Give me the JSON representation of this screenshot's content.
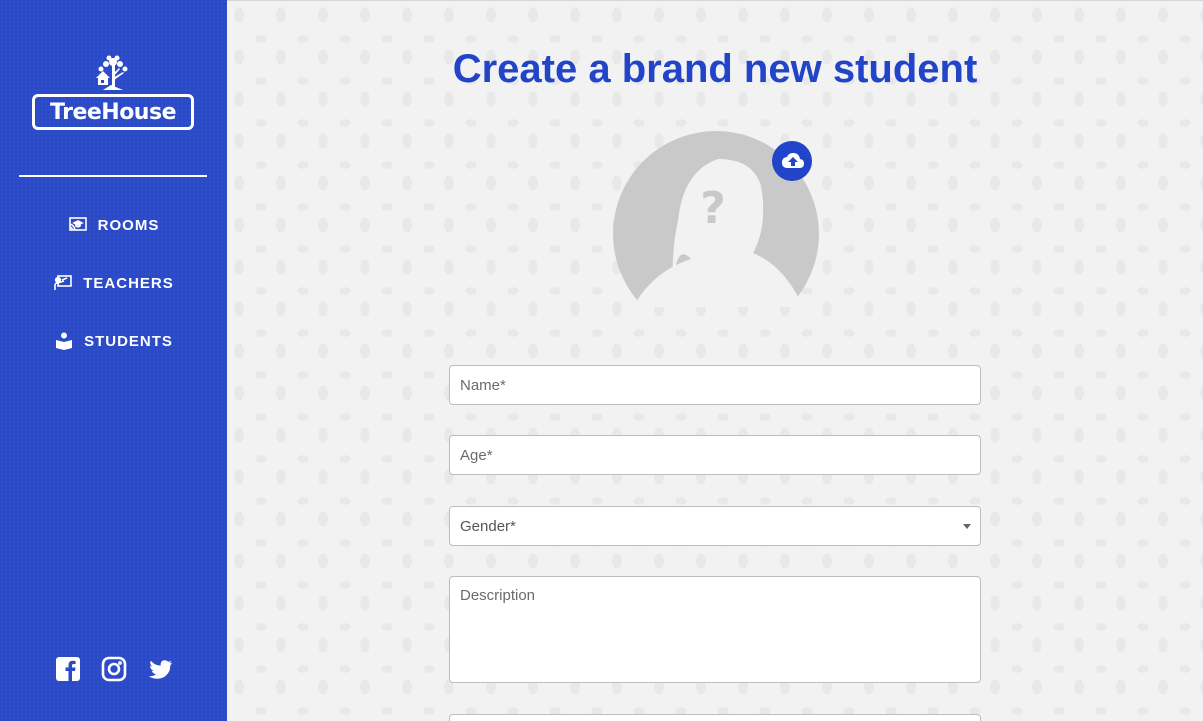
{
  "sidebar": {
    "brand": "TreeHouse",
    "nav": [
      {
        "label": "ROOMS",
        "icon": "rooms-icon"
      },
      {
        "label": "TEACHERS",
        "icon": "teachers-icon"
      },
      {
        "label": "STUDENTS",
        "icon": "students-icon"
      }
    ],
    "social": [
      "facebook-icon",
      "instagram-icon",
      "twitter-icon"
    ]
  },
  "main": {
    "title": "Create a brand new student",
    "form": {
      "name_placeholder": "Name*",
      "age_placeholder": "Age*",
      "gender_placeholder": "Gender*",
      "description_placeholder": "Description"
    }
  },
  "colors": {
    "accent": "#2144c9",
    "sidebar": "#2b4ac7",
    "background": "#f2f2f2"
  }
}
